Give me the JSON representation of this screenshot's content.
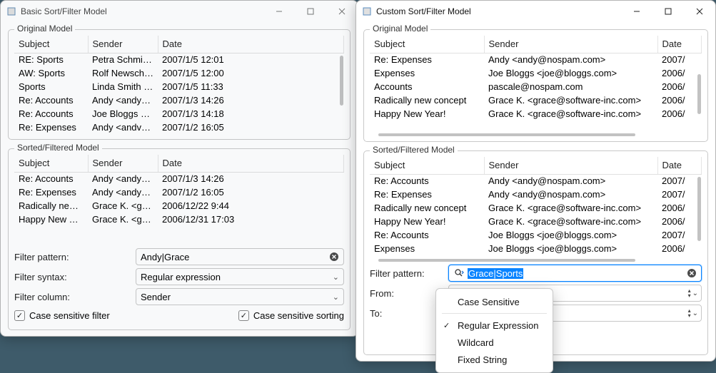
{
  "basic": {
    "title": "Basic Sort/Filter Model",
    "original_group": "Original Model",
    "sorted_group": "Sorted/Filtered Model",
    "headers": {
      "subject": "Subject",
      "sender": "Sender",
      "date": "Date"
    },
    "original_rows": [
      {
        "subject": "RE: Sports",
        "sender": "Petra Schmidt…",
        "date": "2007/1/5 12:01"
      },
      {
        "subject": "AW: Sports",
        "sender": "Rolf Newschw…",
        "date": "2007/1/5 12:00"
      },
      {
        "subject": "Sports",
        "sender": "Linda Smith <l…",
        "date": "2007/1/5 11:33"
      },
      {
        "subject": "Re: Accounts",
        "sender": "Andy <andy@…",
        "date": "2007/1/3 14:26"
      },
      {
        "subject": "Re: Accounts",
        "sender": "Joe Bloggs <j…",
        "date": "2007/1/3 14:18"
      },
      {
        "subject": "Re: Expenses",
        "sender": "Andy <andv@…",
        "date": "2007/1/2 16:05"
      }
    ],
    "sorted_rows": [
      {
        "subject": "Re: Accounts",
        "sender": "Andy <andy@…",
        "date": "2007/1/3 14:26"
      },
      {
        "subject": "Re: Expenses",
        "sender": "Andy <andy@…",
        "date": "2007/1/2 16:05"
      },
      {
        "subject": "Radically new …",
        "sender": "Grace K. <gra…",
        "date": "2006/12/22 9:44"
      },
      {
        "subject": "Happy New Y…",
        "sender": "Grace K. <gra…",
        "date": "2006/12/31 17:03"
      }
    ],
    "filter_pattern_label": "Filter pattern:",
    "filter_pattern_value": "Andy|Grace",
    "filter_syntax_label": "Filter syntax:",
    "filter_syntax_value": "Regular expression",
    "filter_column_label": "Filter column:",
    "filter_column_value": "Sender",
    "cs_filter": "Case sensitive filter",
    "cs_sort": "Case sensitive sorting"
  },
  "custom": {
    "title": "Custom Sort/Filter Model",
    "original_group": "Original Model",
    "sorted_group": "Sorted/Filtered Model",
    "headers": {
      "subject": "Subject",
      "sender": "Sender",
      "date": "Date"
    },
    "original_rows": [
      {
        "subject": "Re: Expenses",
        "sender": "Andy <andy@nospam.com>",
        "date": "2007/"
      },
      {
        "subject": "Expenses",
        "sender": "Joe Bloggs <joe@bloggs.com>",
        "date": "2006/"
      },
      {
        "subject": "Accounts",
        "sender": "pascale@nospam.com",
        "date": "2006/"
      },
      {
        "subject": "Radically new concept",
        "sender": "Grace K. <grace@software-inc.com>",
        "date": "2006/"
      },
      {
        "subject": "Happy New Year!",
        "sender": "Grace K. <grace@software-inc.com>",
        "date": "2006/"
      }
    ],
    "sorted_rows": [
      {
        "subject": "Re: Accounts",
        "sender": "Andy <andy@nospam.com>",
        "date": "2007/"
      },
      {
        "subject": "Re: Expenses",
        "sender": "Andy <andy@nospam.com>",
        "date": "2007/"
      },
      {
        "subject": "Radically new concept",
        "sender": "Grace K. <grace@software-inc.com>",
        "date": "2006/"
      },
      {
        "subject": "Happy New Year!",
        "sender": "Grace K. <grace@software-inc.com>",
        "date": "2006/"
      },
      {
        "subject": "Re: Accounts",
        "sender": "Joe Bloggs <joe@bloggs.com>",
        "date": "2007/"
      },
      {
        "subject": "Expenses",
        "sender": "Joe Bloggs <joe@bloggs.com>",
        "date": "2006/"
      }
    ],
    "filter_pattern_label": "Filter pattern:",
    "filter_pattern_value": "Grace|Sports",
    "from_label": "From:",
    "to_label": "To:",
    "menu": {
      "case_sensitive": "Case Sensitive",
      "regex": "Regular Expression",
      "wildcard": "Wildcard",
      "fixed": "Fixed String"
    }
  }
}
